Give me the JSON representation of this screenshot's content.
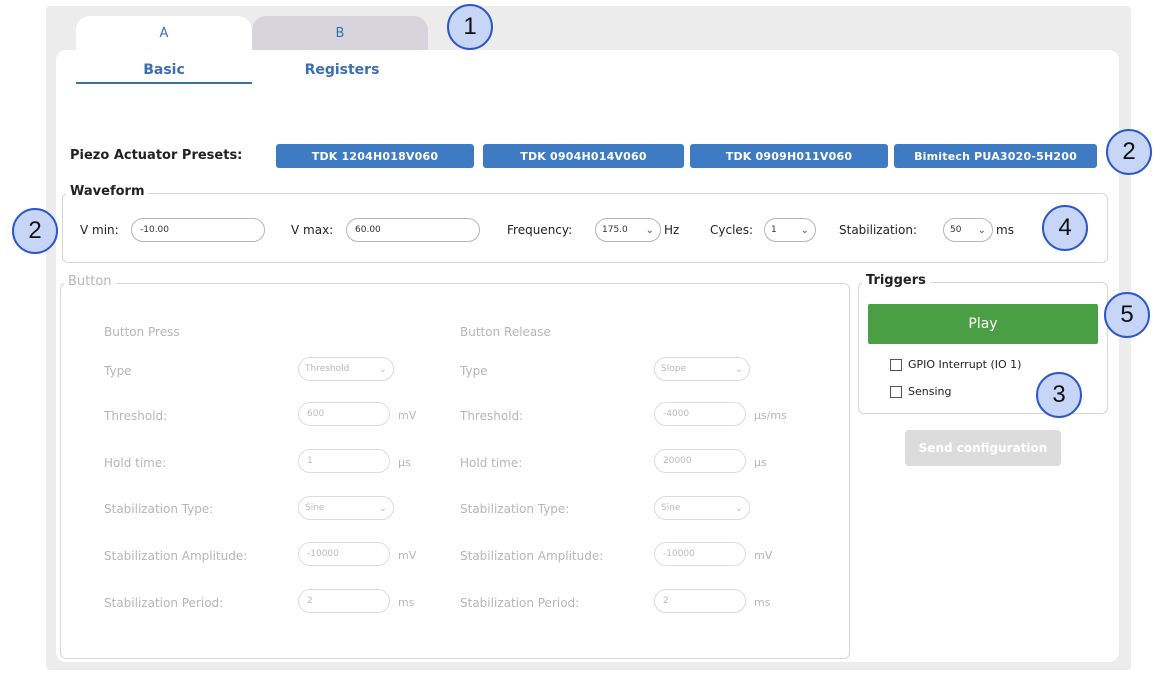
{
  "tabs": [
    {
      "label": "A"
    },
    {
      "label": "B"
    }
  ],
  "subtabs": [
    {
      "label": "Basic"
    },
    {
      "label": "Registers"
    }
  ],
  "presets": {
    "label": "Piezo Actuator Presets:",
    "buttons": [
      "TDK 1204H018V060",
      "TDK 0904H014V060",
      "TDK 0909H011V060",
      "Bimitech PUA3020-5H200"
    ]
  },
  "waveform": {
    "title": "Waveform",
    "vmin_label": "V min:",
    "vmin_value": "-10.00",
    "vmax_label": "V max:",
    "vmax_value": "60.00",
    "freq_label": "Frequency:",
    "freq_value": "175.0",
    "freq_unit": "Hz",
    "cycles_label": "Cycles:",
    "cycles_value": "1",
    "stab_label": "Stabilization:",
    "stab_value": "50",
    "stab_unit": "ms"
  },
  "button_group": {
    "title": "Button",
    "press": {
      "header": "Button Press",
      "type_label": "Type",
      "type_value": "Threshold",
      "threshold_label": "Threshold:",
      "threshold_value": "600",
      "threshold_unit": "mV",
      "hold_label": "Hold time:",
      "hold_value": "1",
      "hold_unit": "μs",
      "stab_type_label": "Stabilization  Type:",
      "stab_type_value": "Sine",
      "stab_amp_label": "Stabilization Amplitude:",
      "stab_amp_value": "-10000",
      "stab_amp_unit": "mV",
      "stab_period_label": "Stabilization Period:",
      "stab_period_value": "2",
      "stab_period_unit": "ms"
    },
    "release": {
      "header": "Button Release",
      "type_label": "Type",
      "type_value": "Slope",
      "threshold_label": "Threshold:",
      "threshold_value": "-4000",
      "threshold_unit": "μs/ms",
      "hold_label": "Hold time:",
      "hold_value": "20000",
      "hold_unit": "μs",
      "stab_type_label": "Stabilization  Type:",
      "stab_type_value": "Sine",
      "stab_amp_label": "Stabilization Amplitude:",
      "stab_amp_value": "-10000",
      "stab_amp_unit": "mV",
      "stab_period_label": "Stabilization Period:",
      "stab_period_value": "2",
      "stab_period_unit": "ms"
    }
  },
  "triggers": {
    "title": "Triggers",
    "play_label": "Play",
    "gpio_label": "GPIO Interrupt (IO 1)",
    "sensing_label": "Sensing"
  },
  "send_label": "Send configuration",
  "callouts": [
    "1",
    "2",
    "2",
    "4",
    "5",
    "3"
  ],
  "colors": {
    "accent": "#3a6fb0",
    "preset": "#3f7bc2",
    "play": "#4a9e43",
    "callout": "#c7d5f7"
  }
}
